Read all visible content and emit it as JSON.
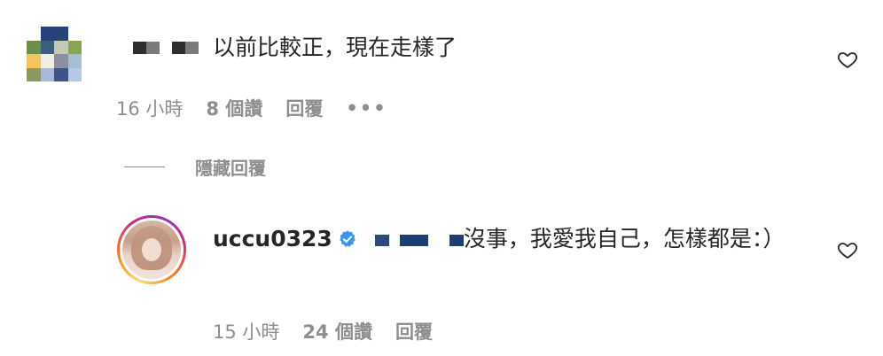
{
  "comment": {
    "text": "以前比較正，現在走樣了",
    "time": "16 小時",
    "likes": "8 個讚",
    "reply": "回覆",
    "more": "•••",
    "avatar_colors": [
      [
        "#ffffff",
        "#27437a",
        "#27437a",
        "#ffffff"
      ],
      [
        "#6e8f4a",
        "#3b5f7d",
        "#c3c9b4",
        "#8aa456"
      ],
      [
        "#f5c55b",
        "#efefe6",
        "#8b8fa0",
        "#a6bdd8"
      ],
      [
        "#8a9a5e",
        "#a9b8d4",
        "#3c5487",
        "#b7c7e5"
      ]
    ],
    "redaction_colors": [
      "#2e2e2e",
      "#7a7a7a",
      "#2e2e2e",
      "#7a7a7a"
    ]
  },
  "hide_replies": {
    "label": "隱藏回覆"
  },
  "reply": {
    "username": "uccu0323",
    "text": "沒事，我愛我自己，怎樣都是：）",
    "time": "15 小時",
    "likes": "24 個讚",
    "reply": "回覆",
    "verified_color": "#3897f0",
    "redaction_color": "#2c4a7e"
  }
}
